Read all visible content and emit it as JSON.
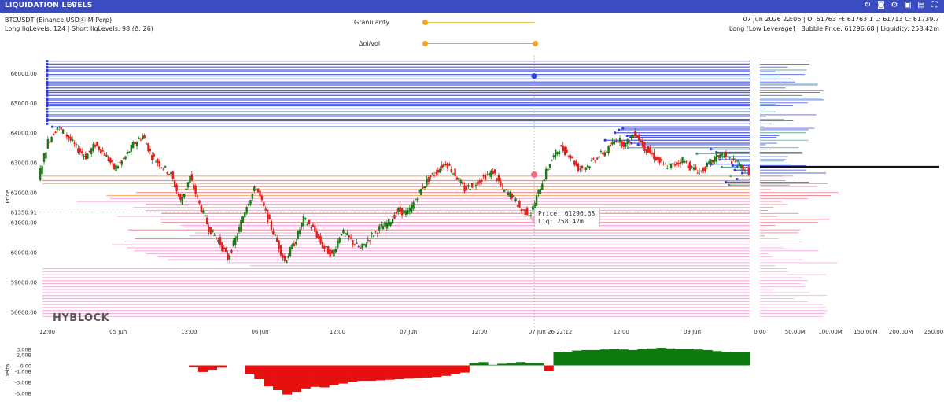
{
  "window": {
    "title": "LIQUIDATION LEVELS",
    "toolbar_icons": [
      "refresh-icon",
      "camera-icon",
      "settings-icon",
      "download-icon",
      "save-icon",
      "fullscreen-icon"
    ]
  },
  "header": {
    "symbol_line": "BTCUSDT (Binance USDⓈ-M Perp)",
    "levels_line": "Long liqLevels: 124 | Short liqLevels: 98 (Δ: 26)",
    "ohlc_line": "07 Jun 2026 22:06 | O: 61763 H: 61763.1 L: 61713 C: 61739.7",
    "detail_line": "Long [Low Leverage] | Bubble Price: 61296.68 | Liquidity: 258.42m"
  },
  "controls": {
    "granularity_label": "Granularity",
    "oi_vol_label": "Δoi/vol",
    "granularity_value": 0.0,
    "oi_vol_range": [
      0.0,
      1.0
    ]
  },
  "tooltip": {
    "price_line": "Price: 61296.68",
    "liq_line": "Liq: 258.42m"
  },
  "watermark": "HYBLOCK",
  "colors": {
    "long": "#2d3fe0",
    "teal": "#3a9a9a",
    "short": "#f07080",
    "pink": "#f5a0d8",
    "orange": "#f7a05a",
    "up": "#1a7a1a",
    "down": "#e0201a"
  },
  "chart_data": [
    {
      "type": "line",
      "name": "price",
      "ylabel": "Price",
      "ylim": [
        57700,
        66600
      ],
      "y_ticks": [
        "66000.00",
        "65000.00",
        "64000.00",
        "63000.00",
        "62000.00",
        "61000.00",
        "60000.00",
        "59000.00",
        "58000.00"
      ],
      "y_tick_values": [
        66000,
        65000,
        64000,
        63000,
        62000,
        61000,
        60000,
        59000,
        58000
      ],
      "current_price_label": "61350.91",
      "current_price": 61350.91,
      "x_ticks": [
        "12:00",
        "05 Jun",
        "12:00",
        "06 Jun",
        "12:00",
        "07 Jun",
        "12:00",
        "07 Jun 26 22:12",
        "12:00",
        "09 Jun"
      ],
      "x_tick_positions": [
        0.0,
        0.11,
        0.22,
        0.33,
        0.45,
        0.56,
        0.67,
        0.78,
        0.89,
        1.0
      ],
      "crosshair_x_label": "07 Jun 26 22:12",
      "price_series": [
        62500,
        63700,
        64200,
        63900,
        63500,
        63200,
        63600,
        63300,
        62800,
        63100,
        63600,
        63900,
        63200,
        62900,
        62600,
        61700,
        62500,
        61600,
        60800,
        60400,
        59800,
        60600,
        61600,
        62200,
        61300,
        60500,
        59700,
        60300,
        61100,
        60800,
        60200,
        59900,
        60700,
        60400,
        60100,
        60500,
        60800,
        61000,
        61400,
        61300,
        61900,
        62400,
        62700,
        63000,
        62600,
        62100,
        62300,
        62500,
        62700,
        62100,
        61900,
        61400,
        61300,
        62200,
        63000,
        63500,
        63300,
        62800,
        62900,
        63200,
        63400,
        63800,
        63600,
        64000,
        63500,
        63200,
        62900,
        62900,
        63100,
        62800,
        62700,
        63000,
        63300,
        63100,
        62900,
        62700
      ],
      "long_levels_y": [
        66400,
        66300,
        66200,
        66100,
        66050,
        65950,
        65900,
        65800,
        65700,
        65650,
        65600,
        65500,
        65400,
        65350,
        65250,
        65150,
        65100,
        65000,
        64950,
        64900,
        64800,
        64700,
        64600,
        64550,
        64450,
        64400,
        64300,
        64200,
        64150,
        64100,
        64000,
        63900,
        63850,
        63750,
        63650,
        63600,
        63500,
        63450,
        63350,
        63300,
        63200,
        63100,
        63050,
        62950,
        62900,
        62850,
        62750,
        62650,
        62550,
        62450,
        62350,
        62250
      ],
      "short_levels_y": [
        62550,
        62400,
        62300,
        62200,
        62100,
        62000,
        61900,
        61800,
        61700,
        61600,
        61500,
        61400,
        61300,
        61200,
        61100,
        61000,
        60900,
        60850,
        60750,
        60650,
        60550,
        60450,
        60350,
        60250,
        60150,
        60050,
        59950,
        59850,
        59750,
        59650,
        59550,
        59450,
        59350,
        59250,
        59150,
        59050,
        58950,
        58850,
        58750,
        58650,
        58550,
        58450,
        58350,
        58250,
        58150,
        58050,
        57950,
        57850
      ]
    },
    {
      "type": "bar",
      "name": "liquidity profile",
      "x_ticks": [
        "0.00",
        "50.00M",
        "100.00M",
        "150.00M",
        "200.00M",
        "250.00M"
      ],
      "x_tick_values": [
        0,
        50,
        100,
        150,
        200,
        250
      ],
      "xlim": [
        0,
        250
      ]
    },
    {
      "type": "area",
      "name": "Delta",
      "ylabel": "Delta",
      "y_ticks": [
        "3.00B",
        "2.00B",
        "0.00",
        "-1.00B",
        "-3.00B",
        "-5.00B"
      ],
      "y_tick_values": [
        3,
        2,
        0,
        -1,
        -3,
        -5
      ],
      "ylim": [
        -5.5,
        3.5
      ],
      "values": [
        0.0,
        0.0,
        0.0,
        0.0,
        0.0,
        0.0,
        0.0,
        0.0,
        0.0,
        0.0,
        0.0,
        0.0,
        0.0,
        0.0,
        0.0,
        0.0,
        -0.3,
        -1.2,
        -0.8,
        -0.4,
        0.0,
        0.0,
        -1.5,
        -2.5,
        -3.8,
        -4.5,
        -5.3,
        -4.8,
        -4.2,
        -3.9,
        -4.0,
        -3.6,
        -3.3,
        -3.0,
        -2.8,
        -2.8,
        -2.7,
        -2.6,
        -2.5,
        -2.4,
        -2.3,
        -2.2,
        -2.1,
        -1.9,
        -1.6,
        -1.3,
        0.4,
        0.6,
        0.1,
        0.3,
        0.4,
        0.6,
        0.5,
        0.4,
        -1.0,
        2.4,
        2.5,
        2.7,
        2.8,
        2.8,
        2.9,
        3.0,
        2.9,
        2.8,
        3.0,
        3.1,
        3.2,
        3.1,
        3.0,
        3.0,
        2.9,
        2.8,
        2.6,
        2.5,
        2.4,
        2.4
      ]
    }
  ]
}
